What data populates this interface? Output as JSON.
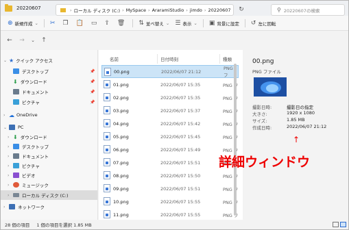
{
  "window": {
    "title": "20220607"
  },
  "toolbar": {
    "new_label": "新規作成",
    "sort_label": "並べ替え",
    "view_label": "表示",
    "set_bg_label": "背景に設定",
    "rotate_left_label": "左に回転"
  },
  "address": {
    "breadcrumbs": [
      "ローカル ディスク (C:)",
      "MySpace",
      "AraramiStudio",
      "jimdo",
      "20220607"
    ],
    "search_placeholder": "20220607の検索"
  },
  "nav": {
    "quick_access": "クイック アクセス",
    "quick_items": [
      "デスクトップ",
      "ダウンロード",
      "ドキュメント",
      "ピクチャ"
    ],
    "onedrive": "OneDrive",
    "pc": "PC",
    "pc_items": [
      "ダウンロード",
      "デスクトップ",
      "ドキュメント",
      "ピクチャ",
      "ビデオ",
      "ミュージック",
      "ローカル ディスク (C:)"
    ],
    "network": "ネットワーク"
  },
  "columns": {
    "name": "名前",
    "date": "日付時刻",
    "type": "種類"
  },
  "files": [
    {
      "name": "00.png",
      "date": "2022/06/07 21:12",
      "type": "PNG フ"
    },
    {
      "name": "01.png",
      "date": "2022/06/07 15:35",
      "type": "PNG フ"
    },
    {
      "name": "02.png",
      "date": "2022/06/07 15:35",
      "type": "PNG フ"
    },
    {
      "name": "03.png",
      "date": "2022/06/07 15:37",
      "type": "PNG フ"
    },
    {
      "name": "04.png",
      "date": "2022/06/07 15:42",
      "type": "PNG フ"
    },
    {
      "name": "05.png",
      "date": "2022/06/07 15:45",
      "type": "PNG フ"
    },
    {
      "name": "06.png",
      "date": "2022/06/07 15:49",
      "type": "PNG フ"
    },
    {
      "name": "07.png",
      "date": "2022/06/07 15:51",
      "type": "PNG フ"
    },
    {
      "name": "08.png",
      "date": "2022/06/07 15:50",
      "type": "PNG フ"
    },
    {
      "name": "09.png",
      "date": "2022/06/07 15:51",
      "type": "PNG フ"
    },
    {
      "name": "10.png",
      "date": "2022/06/07 15:55",
      "type": "PNG フ"
    },
    {
      "name": "11.png",
      "date": "2022/06/07 15:55",
      "type": "PNG フ"
    }
  ],
  "selected_index": 0,
  "details": {
    "name": "00.png",
    "type": "PNG ファイル",
    "props": [
      {
        "label": "撮影日時:",
        "value": "撮影日の指定"
      },
      {
        "label": "大きさ:",
        "value": "1920 x 1080"
      },
      {
        "label": "サイズ:",
        "value": "1.85 MB"
      },
      {
        "label": "作成日時:",
        "value": "2022/06/07 21:12"
      }
    ]
  },
  "annotation": {
    "arrow": "↑",
    "text": "詳細ウィンドウ",
    "color": "#e00000"
  },
  "status": {
    "count": "28 個の項目",
    "selected": "1 個の項目を選択 1.85 MB"
  },
  "colors": {
    "selection": "#cce4f7",
    "accent": "#2a6bcf",
    "folder": "#e8b72f"
  }
}
